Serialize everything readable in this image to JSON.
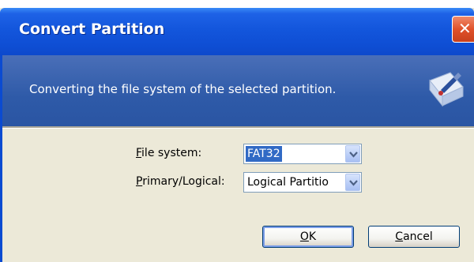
{
  "window": {
    "title": "Convert Partition",
    "close_symbol": "✕"
  },
  "header": {
    "description": "Converting the file system of the selected partition.",
    "icon": "partition-wizard-icon"
  },
  "form": {
    "file_system": {
      "label_mnemonic": "F",
      "label_rest": "ile system:",
      "value": "FAT32"
    },
    "primary_logical": {
      "label_mnemonic": "P",
      "label_rest": "rimary/Logical:",
      "value": "Logical Partitio"
    }
  },
  "buttons": {
    "ok_mnemonic": "O",
    "ok_rest": "K",
    "cancel_mnemonic": "C",
    "cancel_rest": "ancel"
  }
}
